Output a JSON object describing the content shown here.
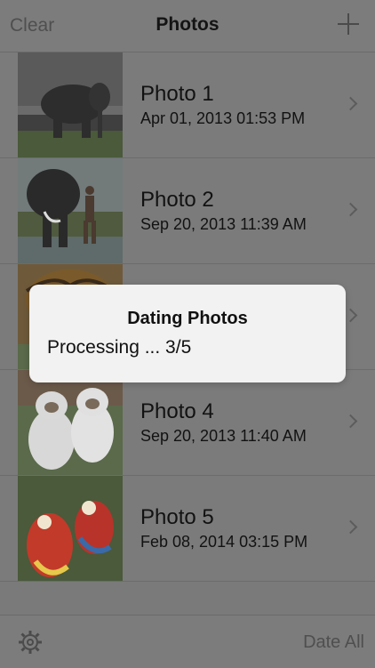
{
  "navbar": {
    "left_label": "Clear",
    "title": "Photos",
    "right_icon": "plus-icon"
  },
  "photos": [
    {
      "title": "Photo 1",
      "date": "Apr 01, 2013 01:53 PM"
    },
    {
      "title": "Photo 2",
      "date": "Sep 20, 2013 11:39 AM"
    },
    {
      "title": "",
      "date": ""
    },
    {
      "title": "Photo 4",
      "date": "Sep 20, 2013 11:40 AM"
    },
    {
      "title": "Photo 5",
      "date": "Feb 08, 2014 03:15 PM"
    }
  ],
  "toolbar": {
    "settings_icon": "gear-icon",
    "date_all_label": "Date All"
  },
  "alert": {
    "title": "Dating Photos",
    "message": "Processing ... 3/5",
    "progress": {
      "current": 3,
      "total": 5
    }
  }
}
